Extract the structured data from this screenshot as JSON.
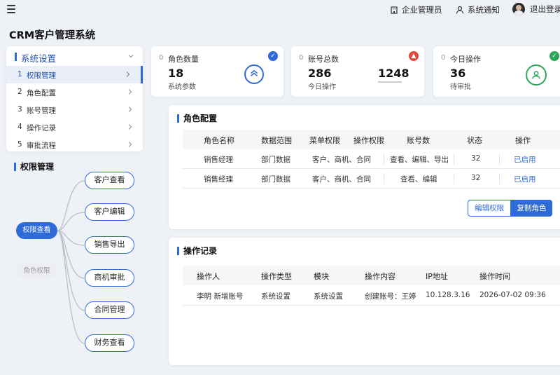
{
  "topbar": {
    "enterprise_admin": "企业管理员",
    "notifications": "系统通知",
    "logout": "退出登录"
  },
  "app": {
    "title": "CRM客户管理系统"
  },
  "colors": {
    "accent": "#2f6bd8",
    "success": "#2aa55a",
    "danger": "#e04a3a"
  },
  "sidebar": {
    "header": "系统设置",
    "items": [
      {
        "num": "1",
        "label": "权限管理"
      },
      {
        "num": "2",
        "label": "角色配置"
      },
      {
        "num": "3",
        "label": "账号管理"
      },
      {
        "num": "4",
        "label": "操作记录"
      },
      {
        "num": "5",
        "label": "审批流程"
      }
    ]
  },
  "perm_tree": {
    "title": "权限管理",
    "root": "权限查看",
    "secondary": "角色权限",
    "leaves": [
      "客户查看",
      "客户编辑",
      "销售导出",
      "商机审批",
      "合同管理",
      "财务查看"
    ]
  },
  "stats": {
    "roles": {
      "dot": "0",
      "label": "角色数量",
      "value": "18",
      "sub": "系统参数"
    },
    "accounts": {
      "dot": "0",
      "label": "账号总数",
      "value": "286",
      "sub": "今日操作",
      "value2": "1248"
    },
    "today": {
      "dot": "0",
      "label": "今日操作",
      "value": "36",
      "sub": "待审批"
    }
  },
  "roles_section": {
    "title": "角色配置",
    "columns": [
      "角色名称",
      "数据范围",
      "菜单权限",
      "操作权限",
      "账号数",
      "状态",
      "操作"
    ],
    "rows": [
      {
        "name": "销售经理",
        "scope": "部门数据",
        "menu": "客户、商机、合同",
        "ops": "查看、编辑、导出",
        "count": "32",
        "status": "已启用"
      },
      {
        "name": "销售经理",
        "scope": "部门数据",
        "menu": "客户、商机、合同",
        "ops": "查看、编辑",
        "count": "32",
        "status": "已启用"
      }
    ],
    "edit_btn": "编辑权限",
    "copy_btn": "复制角色"
  },
  "log_section": {
    "title": "操作记录",
    "columns": [
      "操作人",
      "操作类型",
      "模块",
      "操作内容",
      "IP地址",
      "操作时间"
    ],
    "rows": [
      {
        "user": "李明 新增账号",
        "type": "系统设置",
        "module": "系统设置",
        "content": "创建账号：王婷",
        "ip": "10.128.3.16",
        "time": "2026-07-02 09:36"
      }
    ]
  }
}
